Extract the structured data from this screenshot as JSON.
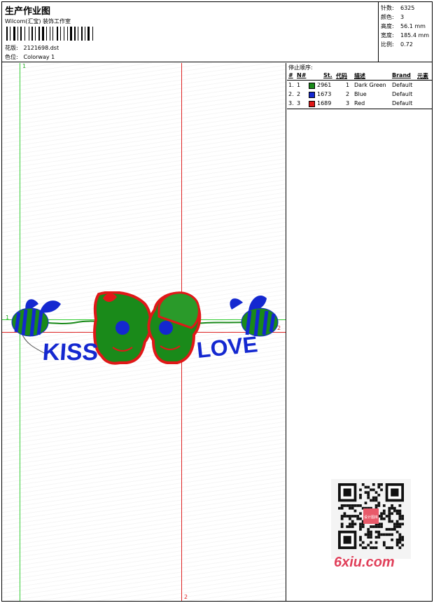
{
  "header": {
    "title": "生产作业图",
    "company": "Wilcom(汇宝) 装饰工作室",
    "design_label": "花版:",
    "design_value": "2121698.dst",
    "colorway_label": "色位:",
    "colorway_value": "Colorway 1"
  },
  "stats": [
    {
      "label": "针数:",
      "value": "6325"
    },
    {
      "label": "颜色:",
      "value": "3"
    },
    {
      "label": "高度:",
      "value": "56.1 mm"
    },
    {
      "label": "宽度:",
      "value": "185.4 mm"
    },
    {
      "label": "比例:",
      "value": "0.72"
    }
  ],
  "canvas": {
    "guide_top_label": "1",
    "guide_left_label": "1",
    "guide_right_label": "2",
    "guide_bottom_label": "2",
    "text_kiss": "KISS",
    "text_love": "LOVE"
  },
  "stop_sequence": {
    "title": "停止顺序:",
    "columns": [
      "#",
      "N#",
      "St.",
      "代码",
      "描述",
      "Brand",
      "元素"
    ],
    "rows": [
      {
        "seq": "1.",
        "n": "1",
        "st": "2961",
        "code": "1",
        "desc": "Dark Green",
        "brand": "Default",
        "color": "#1a8a1a"
      },
      {
        "seq": "2.",
        "n": "2",
        "st": "1673",
        "code": "2",
        "desc": "Blue",
        "brand": "Default",
        "color": "#1428d0"
      },
      {
        "seq": "3.",
        "n": "3",
        "st": "1689",
        "code": "3",
        "desc": "Red",
        "brand": "Default",
        "color": "#e01818"
      }
    ]
  },
  "qr": {
    "stamp_text": "设计图库",
    "watermark": "6xiu.com"
  }
}
